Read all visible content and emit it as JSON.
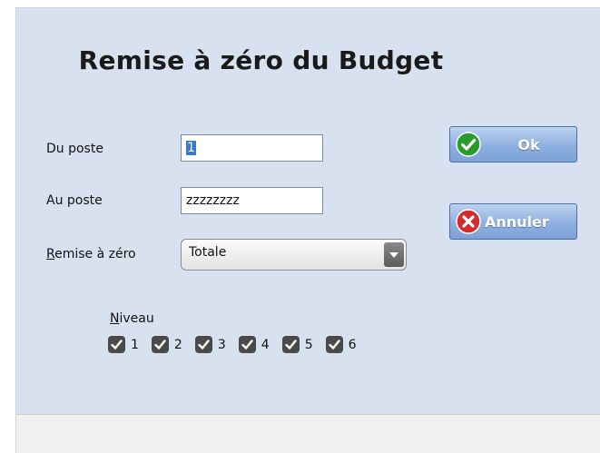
{
  "dialog": {
    "title": "Remise à zéro du Budget"
  },
  "form": {
    "du_poste": {
      "label": "Du poste",
      "value": "1"
    },
    "au_poste": {
      "label": "Au poste",
      "value": "zzzzzzzz"
    },
    "remise": {
      "label_accel": "R",
      "label_rest": "emise à zéro",
      "value": "Totale"
    }
  },
  "buttons": {
    "ok": {
      "label": "Ok",
      "icon": "check-icon",
      "color": "#2a9a2a"
    },
    "annuler": {
      "label": "Annuler",
      "icon": "cancel-icon",
      "color": "#d22d2d"
    }
  },
  "niveau": {
    "label_accel": "N",
    "label_rest": "iveau",
    "levels": [
      {
        "label": "1",
        "checked": true
      },
      {
        "label": "2",
        "checked": true
      },
      {
        "label": "3",
        "checked": true
      },
      {
        "label": "4",
        "checked": true
      },
      {
        "label": "5",
        "checked": true
      },
      {
        "label": "6",
        "checked": true
      }
    ]
  }
}
